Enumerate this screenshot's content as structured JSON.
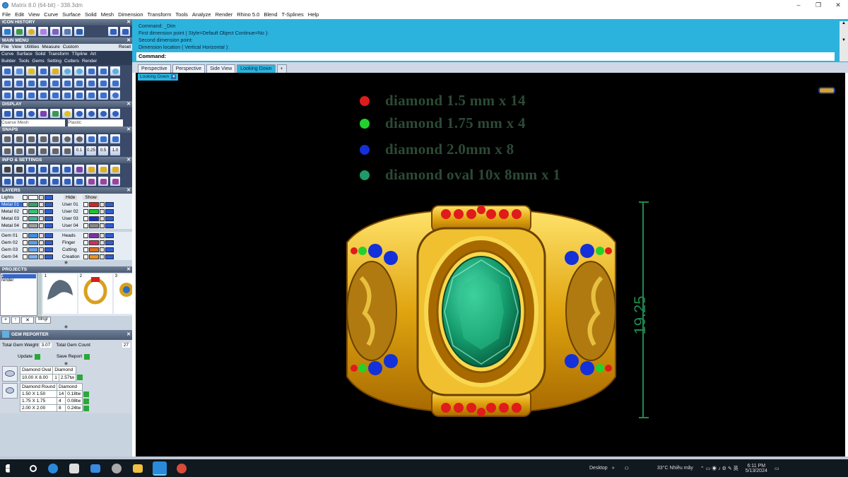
{
  "window": {
    "title": "Matrix 8.0 (64-bit) - 338.3dm",
    "minimize": "–",
    "maximize": "❐",
    "close": "✕"
  },
  "menubar": [
    "File",
    "Edit",
    "View",
    "Curve",
    "Surface",
    "Solid",
    "Mesh",
    "Dimension",
    "Transform",
    "Tools",
    "Analyze",
    "Render",
    "Rhino 5.0",
    "Blend",
    "T-Splines",
    "Help"
  ],
  "left": {
    "icon_history": "ICON HISTORY",
    "main_menu": "MAIN MENU",
    "main_menu_row1": [
      "File",
      "View",
      "Utilities",
      "Measure",
      "Custom",
      "Reset"
    ],
    "main_menu_row2": [
      "Curve",
      "Surface",
      "Solid",
      "Transform",
      "TSpline",
      "Art"
    ],
    "main_menu_row3": [
      "Builder",
      "Tools",
      "Gems",
      "Setting",
      "Cutters",
      "Render"
    ],
    "display": "DISPLAY",
    "display_sel1": "Coarse Mesh",
    "display_sel2": "Plastic",
    "snaps": "SNAPS",
    "snap_vals": [
      "0.1",
      "0.25",
      "0.5",
      "1.0"
    ],
    "info_settings": "INFO & SETTINGS",
    "layers": "LAYERS",
    "lights": "Lights",
    "hide": "Hide",
    "show": "Show",
    "metal_layers": [
      "Metal 01",
      "Metal 02",
      "Metal 03",
      "Metal 04"
    ],
    "user_layers": [
      "User 01",
      "User 02",
      "User 03",
      "User 04"
    ],
    "gem_layers": [
      "Gem 01",
      "Gem 02",
      "Gem 03",
      "Gem 04"
    ],
    "misc_layers": [
      "Heads",
      "Finger",
      "Cutting",
      "Creation"
    ],
    "projects": "PROJECTS",
    "project_list_item": "1",
    "project_list_sub": "render",
    "thumb_nums": [
      "1",
      "2",
      "3"
    ],
    "mngr": "Mngr",
    "gem_reporter": "GEM REPORTER",
    "total_gem_weight_label": "Total Gem Weight",
    "total_gem_weight": "3.07",
    "total_gem_count_label": "Total Gem Count",
    "total_gem_count": "27",
    "update": "Update",
    "save_report": "Save Report",
    "gem_table1_head": [
      "Diamond Oval",
      "Diamond"
    ],
    "gem_table1_rows": [
      [
        "10.00 X 8.00",
        "1",
        "2.57tw"
      ]
    ],
    "gem_table2_head": [
      "Diamond Round",
      "Diamond"
    ],
    "gem_table2_rows": [
      [
        "1.50 X 1.50",
        "14",
        "0.18tw"
      ],
      [
        "1.75 X 1.75",
        "4",
        "0.08tw"
      ],
      [
        "2.00 X 2.00",
        "8",
        "0.24tw"
      ]
    ]
  },
  "command": {
    "lines": [
      "Command: _Dim",
      "First dimension point ( Style=Default  Object  Continue=No ):",
      "Second dimension point:",
      "Dimension location ( Vertical  Horizontal ):"
    ],
    "prompt": "Command:"
  },
  "tabs": [
    "Perspective",
    "Perspective",
    "Side View",
    "Looking Down",
    "+"
  ],
  "viewport": {
    "label": "Looking Down",
    "dropdown": "▾",
    "legend": [
      {
        "color": "#e01b1b",
        "text": "diamond 1.5 mm x 14"
      },
      {
        "color": "#22d12c",
        "text": "diamond 1.75 mm x 4"
      },
      {
        "color": "#1430d8",
        "text": "diamond 2.0mm x 8"
      },
      {
        "color": "#1f9a6a",
        "text": "diamond oval 10x 8mm x 1"
      }
    ],
    "dimension": "19.25"
  },
  "taskbar": {
    "desktop": "Desktop",
    "weather": "33°C  Nhiều mây",
    "time": "6:11 PM",
    "date": "5/13/2024"
  }
}
